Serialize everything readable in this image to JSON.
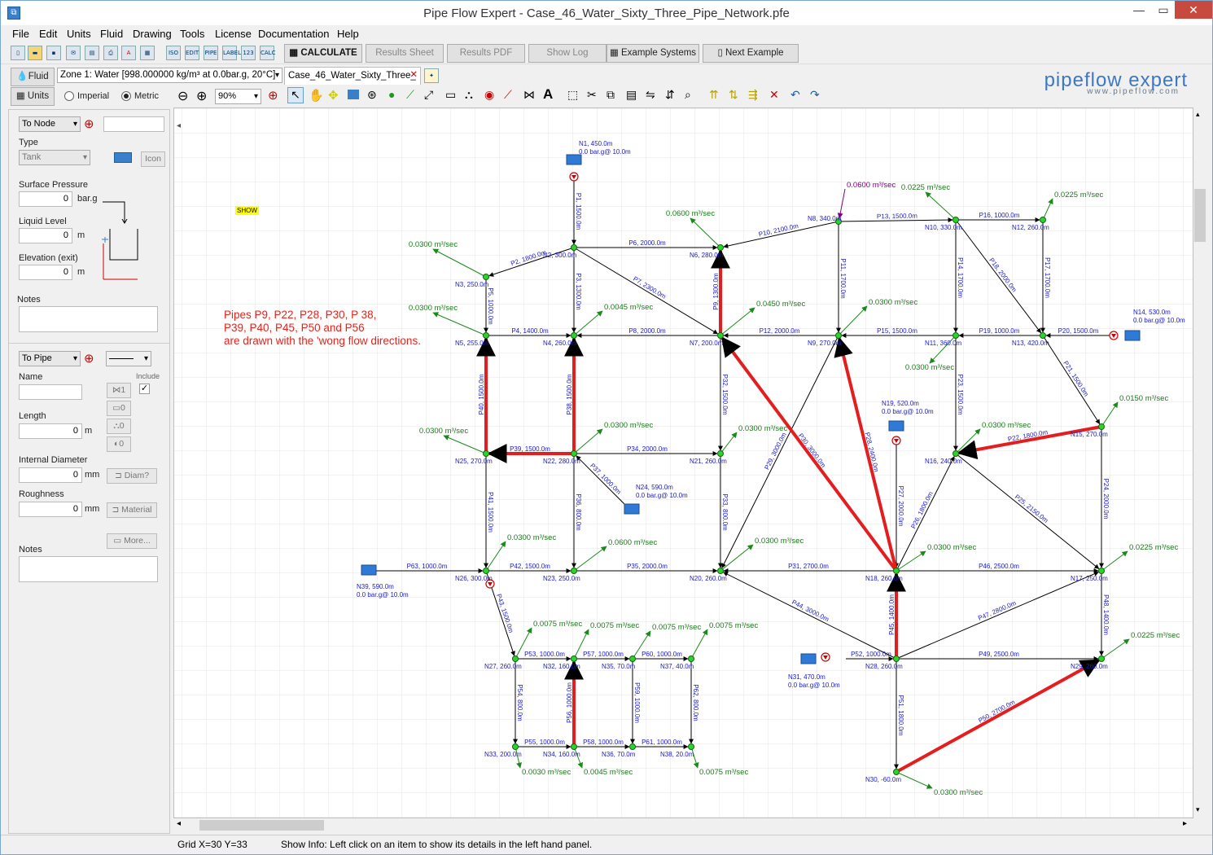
{
  "window": {
    "title": "Pipe Flow Expert - Case_46_Water_Sixty_Three_Pipe_Network.pfe"
  },
  "menu": [
    "File",
    "Edit",
    "Units",
    "Fluid",
    "Drawing",
    "Tools",
    "License",
    "Documentation",
    "Help"
  ],
  "toolbar1": {
    "icons": [
      "ISO",
      "EDIT",
      "PIPE",
      "LABEL",
      "123",
      "CALC"
    ],
    "calculate": "CALCULATE",
    "results_sheet": "Results Sheet",
    "results_pdf": "Results PDF",
    "show_log": "Show Log",
    "example_systems": "Example Systems",
    "next_example": "Next Example"
  },
  "toolbar2": {
    "fluid_button": "Fluid",
    "zone": "Zone 1: Water [998.000000 kg/m³ at 0.0bar.g, 20°C]",
    "tab": "Case_46_Water_Sixty_Three_"
  },
  "toolbar3": {
    "units_button": "Units",
    "imperial": "Imperial",
    "metric": "Metric",
    "zoom": "90%"
  },
  "logo": {
    "main": "pipeflow expert",
    "url": "www.pipeflow.com"
  },
  "left_panel": {
    "node_type_select": "To Node",
    "type_label": "Type",
    "type_value": "Tank",
    "icon_button": "Icon",
    "surface_pressure_label": "Surface Pressure",
    "surface_pressure_value": "0",
    "surface_pressure_unit": "bar.g",
    "liquid_level_label": "Liquid Level",
    "liquid_level_value": "0",
    "liquid_level_unit": "m",
    "elevation_label": "Elevation (exit)",
    "elevation_value": "0",
    "elevation_unit": "m",
    "notes_label": "Notes",
    "pipe_select": "To Pipe",
    "name_label": "Name",
    "include_label": "Include",
    "length_label": "Length",
    "length_value": "0",
    "length_unit": "m",
    "diameter_label": "Internal Diameter",
    "diameter_value": "0",
    "diameter_unit": "mm",
    "diam_button": "Diam?",
    "roughness_label": "Roughness",
    "roughness_value": "0",
    "roughness_unit": "mm",
    "material_button": "Material",
    "more_button": "More...",
    "notes2_label": "Notes",
    "counts": [
      "1",
      "0",
      "0",
      "0"
    ]
  },
  "canvas": {
    "show_label": "SHOW",
    "note_lines": [
      "Pipes P9, P22, P28, P30, P 38,",
      "P39, P40, P45, P50 and P56",
      "are drawn with the 'wong flow directions."
    ]
  },
  "status": {
    "grid": "Grid  X=30  Y=33",
    "info": "Show Info: Left click on an item to show its details in the left hand panel."
  }
}
